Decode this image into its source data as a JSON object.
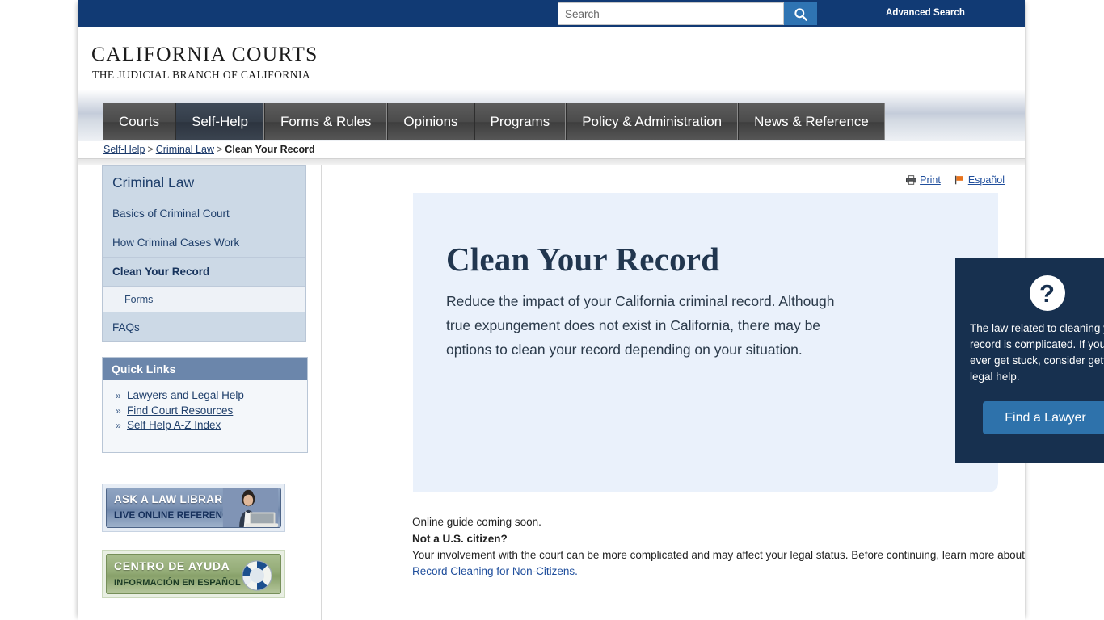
{
  "topbar": {
    "search_placeholder": "Search",
    "search_value": "",
    "search_icon": "search-icon",
    "advanced_search": "Advanced Search"
  },
  "brand": {
    "name": "CALIFORNIA COURTS",
    "tagline": "THE JUDICIAL BRANCH OF CALIFORNIA"
  },
  "nav": {
    "items": [
      {
        "label": "Courts",
        "active": false
      },
      {
        "label": "Self-Help",
        "active": true
      },
      {
        "label": "Forms & Rules",
        "active": false
      },
      {
        "label": "Opinions",
        "active": false
      },
      {
        "label": "Programs",
        "active": false
      },
      {
        "label": "Policy & Administration",
        "active": false
      },
      {
        "label": "News & Reference",
        "active": false
      }
    ]
  },
  "breadcrumb": {
    "item1": "Self-Help",
    "sep1": ">",
    "item2": "Criminal Law",
    "sep2": ">",
    "current": "Clean Your Record"
  },
  "sidebar": {
    "section_title": "Criminal Law",
    "items": [
      {
        "label": "Basics of Criminal Court",
        "current": false,
        "sub": false
      },
      {
        "label": "How Criminal Cases Work",
        "current": false,
        "sub": false
      },
      {
        "label": "Clean Your Record",
        "current": true,
        "sub": false
      },
      {
        "label": "Forms",
        "current": false,
        "sub": true
      },
      {
        "label": "FAQs",
        "current": false,
        "sub": false
      }
    ],
    "quick_links": {
      "heading": "Quick Links",
      "bullet": "»",
      "links": [
        "Lawyers and Legal Help",
        "Find Court Resources",
        "Self Help A-Z Index"
      ]
    },
    "promos": [
      {
        "line1": "ASK A LAW LIBRARIAN",
        "line2": "LIVE ONLINE REFERENCE",
        "icon": "librarian-photo"
      },
      {
        "line1": "CENTRO DE AYUDA",
        "line2": "INFORMACIÓN EN ESPAÑOL",
        "icon": "life-ring-icon"
      }
    ]
  },
  "content": {
    "util_links": [
      {
        "label": "Print",
        "icon": "printer-icon"
      },
      {
        "label": "Español",
        "icon": "flag-icon"
      }
    ],
    "hero": {
      "title": "Clean Your Record",
      "description": "Reduce the impact of your California criminal record. Although true expungement does not exist in California, there may be options to clean your record depending on your situation."
    },
    "callout": {
      "icon": "question-mark-icon",
      "text": "The law related to cleaning your record is complicated. If you ever get stuck, consider getting legal help.",
      "button_label": "Find a Lawyer"
    },
    "bottom": {
      "line1": "Online guide coming soon.",
      "heading": "Not a U.S. citizen?",
      "body_before": "Your involvement with the court can be more complicated and may affect your legal status.  Before continuing, learn more about ",
      "link": "Record Cleaning for Non-Citizens."
    }
  },
  "colors": {
    "topbar_blue": "#113a74",
    "hero_blue": "#eaf1fb",
    "callout_navy": "#17304f",
    "button_blue": "#2e72ab",
    "quicklinks_header": "#6b86ab",
    "sidebar_item": "#ccd9e6",
    "link_blue": "#1f4e9c"
  }
}
